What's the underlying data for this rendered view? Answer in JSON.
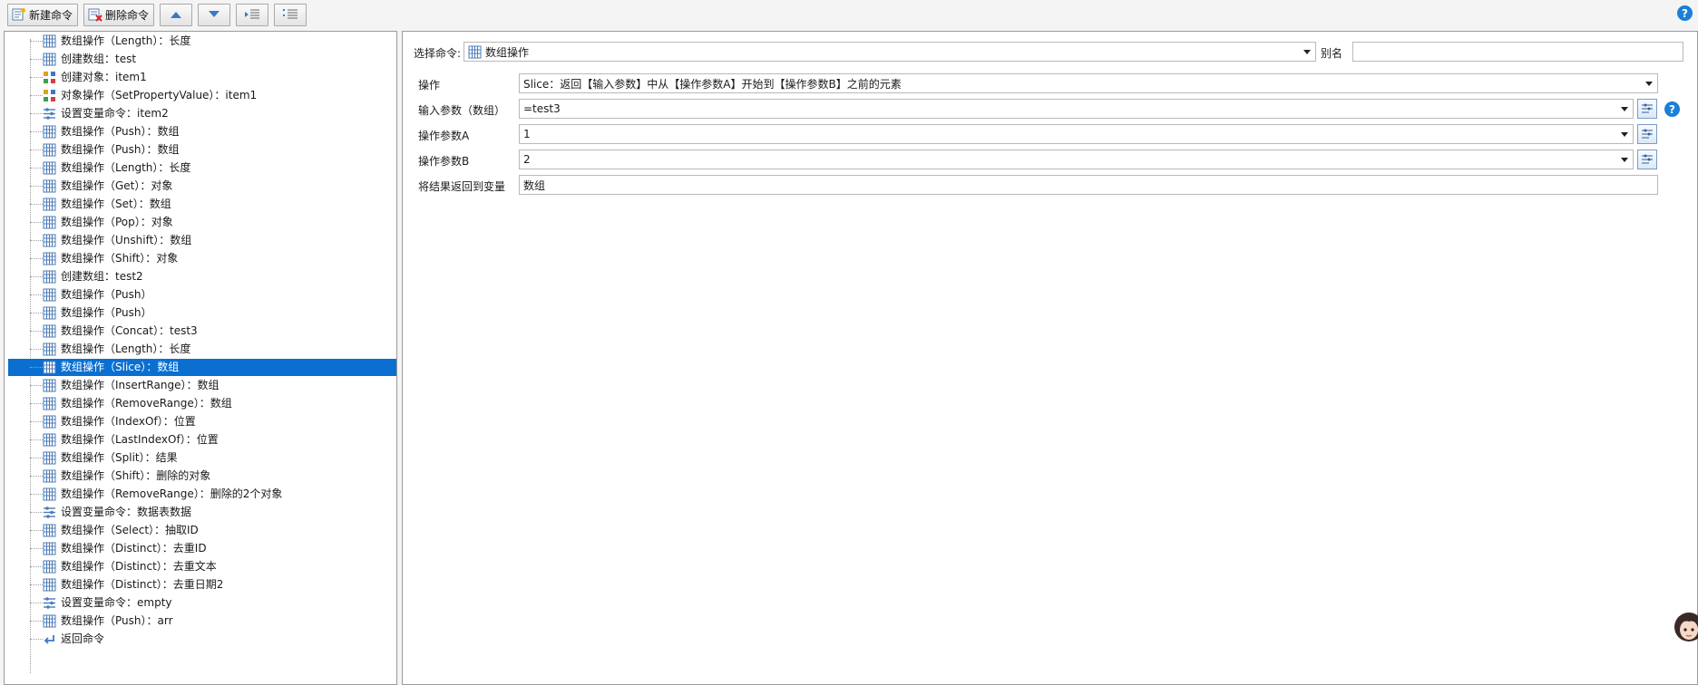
{
  "toolbar": {
    "new_command": "新建命令",
    "delete_command": "删除命令"
  },
  "tree": {
    "items": [
      {
        "label": "数组操作（Length）：长度",
        "icon": "array-icon"
      },
      {
        "label": "创建数组：test",
        "icon": "array-icon"
      },
      {
        "label": "创建对象：item1",
        "icon": "object-icon"
      },
      {
        "label": "对象操作（SetPropertyValue）：item1",
        "icon": "object-icon"
      },
      {
        "label": "设置变量命令：item2",
        "icon": "variable-icon"
      },
      {
        "label": "数组操作（Push）：数组",
        "icon": "array-icon"
      },
      {
        "label": "数组操作（Push）：数组",
        "icon": "array-icon"
      },
      {
        "label": "数组操作（Length）：长度",
        "icon": "array-icon"
      },
      {
        "label": "数组操作（Get）：对象",
        "icon": "array-icon"
      },
      {
        "label": "数组操作（Set）：数组",
        "icon": "array-icon"
      },
      {
        "label": "数组操作（Pop）：对象",
        "icon": "array-icon"
      },
      {
        "label": "数组操作（Unshift）：数组",
        "icon": "array-icon"
      },
      {
        "label": "数组操作（Shift）：对象",
        "icon": "array-icon"
      },
      {
        "label": "创建数组：test2",
        "icon": "array-icon"
      },
      {
        "label": "数组操作（Push）",
        "icon": "array-icon"
      },
      {
        "label": "数组操作（Push）",
        "icon": "array-icon"
      },
      {
        "label": "数组操作（Concat）：test3",
        "icon": "array-icon"
      },
      {
        "label": "数组操作（Length）：长度",
        "icon": "array-icon"
      },
      {
        "label": "数组操作（Slice）：数组",
        "icon": "array-icon",
        "selected": true
      },
      {
        "label": "数组操作（InsertRange）：数组",
        "icon": "array-icon"
      },
      {
        "label": "数组操作（RemoveRange）：数组",
        "icon": "array-icon"
      },
      {
        "label": "数组操作（IndexOf）：位置",
        "icon": "array-icon"
      },
      {
        "label": "数组操作（LastIndexOf）：位置",
        "icon": "array-icon"
      },
      {
        "label": "数组操作（Split）：结果",
        "icon": "array-icon"
      },
      {
        "label": "数组操作（Shift）：删除的对象",
        "icon": "array-icon"
      },
      {
        "label": "数组操作（RemoveRange）：删除的2个对象",
        "icon": "array-icon"
      },
      {
        "label": "设置变量命令：数据表数据",
        "icon": "variable-icon"
      },
      {
        "label": "数组操作（Select）：抽取ID",
        "icon": "array-icon"
      },
      {
        "label": "数组操作（Distinct）：去重ID",
        "icon": "array-icon"
      },
      {
        "label": "数组操作（Distinct）：去重文本",
        "icon": "array-icon"
      },
      {
        "label": "数组操作（Distinct）：去重日期2",
        "icon": "array-icon"
      },
      {
        "label": "设置变量命令：empty",
        "icon": "variable-icon"
      },
      {
        "label": "数组操作（Push）：arr",
        "icon": "array-icon"
      },
      {
        "label": "返回命令",
        "icon": "return-icon"
      }
    ]
  },
  "detail": {
    "select_command_label": "选择命令:",
    "select_command_value": "数组操作",
    "alias_label": "别名",
    "alias_value": "",
    "operation_label": "操作",
    "operation_value": "Slice：返回【输入参数】中从【操作参数A】开始到【操作参数B】之前的元素",
    "input_label": "输入参数（数组）",
    "input_value": "=test3",
    "param_a_label": "操作参数A",
    "param_a_value": "1",
    "param_b_label": "操作参数B",
    "param_b_value": "2",
    "return_label": "将结果返回到变量",
    "return_value": "数组"
  },
  "help": "?"
}
